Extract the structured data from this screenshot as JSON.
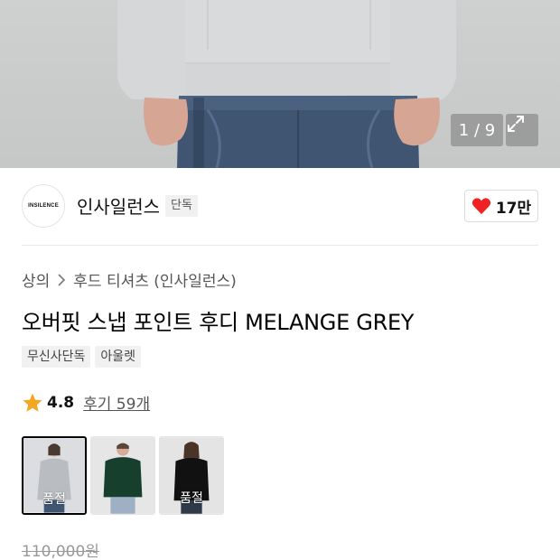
{
  "gallery": {
    "counter": "1 / 9"
  },
  "brand": {
    "logo_text": "INSILENCE",
    "name": "인사일런스",
    "tag": "단독"
  },
  "like": {
    "count": "17만",
    "color": "#ee2222"
  },
  "breadcrumb": {
    "category": "상의",
    "subcategory": "후드 티셔츠 (인사일런스)"
  },
  "product": {
    "title": "오버핏 스냅 포인트 후디 MELANGE GREY",
    "tags": [
      "무신사단독",
      "아울렛"
    ]
  },
  "rating": {
    "score": "4.8",
    "reviews": "후기 59개",
    "star_color": "#f5a623"
  },
  "thumbnails": [
    {
      "color": "#b9bdc1",
      "soldout": "품절"
    },
    {
      "color": "#173f2e",
      "soldout": ""
    },
    {
      "color": "#111111",
      "soldout": "품절"
    }
  ],
  "price": {
    "original": "110,000원"
  }
}
